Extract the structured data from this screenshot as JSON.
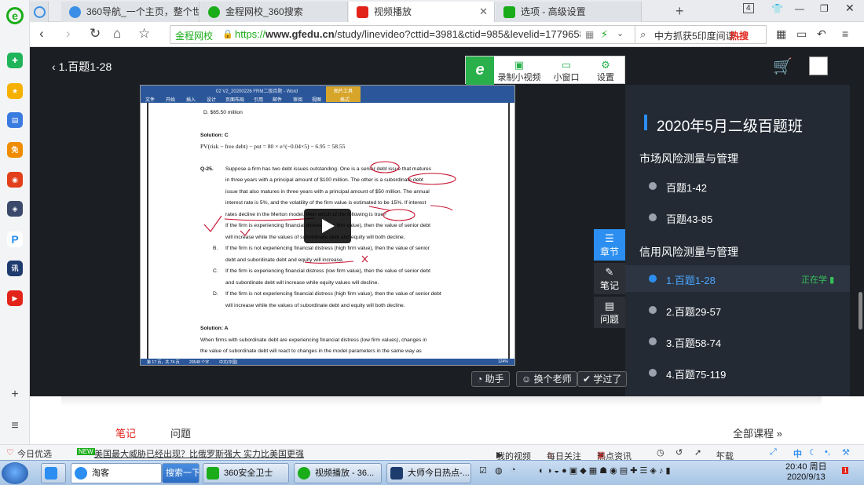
{
  "browser": {
    "tabs": [
      {
        "label": "360导航_一个主页，整个世界",
        "icon_color": "#3a8ee6"
      },
      {
        "label": "金程网校_360搜索",
        "icon_color": "#1aad19"
      },
      {
        "label": "视频播放",
        "icon_color": "#e2231a"
      },
      {
        "label": "选项 - 高级设置",
        "icon_color": "#1aad19"
      }
    ],
    "tab_count": "4",
    "address": {
      "site_badge": "金程网校",
      "scheme": "https://",
      "host": "www.gfedu.cn",
      "path": "/study/linevideo?cttid=3981&ctid=985&levelid=1779658"
    },
    "search": {
      "text": "中方抓获5印度间谍",
      "hot": "热搜"
    },
    "bottom_bar": {
      "weather": "今日优选",
      "news_badge": "NEW",
      "news": "美国最大威胁已经出现？比俄罗斯强大 实力比美国更强",
      "my_video": "我的视频",
      "daily": "每日关注",
      "hot_news": "热点资讯",
      "download": "下载",
      "ime": "中"
    }
  },
  "page": {
    "back_label": "1.百题1-28",
    "tools": [
      {
        "icon": "video-record-icon",
        "label": "录制小视频"
      },
      {
        "icon": "mini-window-icon",
        "label": "小窗口"
      },
      {
        "icon": "gear-icon",
        "label": "设置"
      }
    ],
    "side_buttons": [
      "章节",
      "笔记",
      "问题"
    ],
    "action_buttons": [
      "助手",
      "换个老师",
      "学过了"
    ],
    "bottom_tabs": [
      "笔记",
      "问题"
    ],
    "all_courses": "全部课程"
  },
  "panel": {
    "title": "2020年5月二级百题班",
    "sections": [
      {
        "name": "市场风险测量与管理",
        "items": [
          {
            "label": "百题1-42"
          },
          {
            "label": "百题43-85"
          }
        ]
      },
      {
        "name": "信用风险测量与管理",
        "items": [
          {
            "label": "1.百题1-28",
            "status": "正在学"
          },
          {
            "label": "2.百题29-57"
          },
          {
            "label": "3.百题58-74"
          },
          {
            "label": "4.百题75-119"
          }
        ]
      }
    ]
  },
  "document": {
    "word_title": "02 V2_20200226 FRM二级百题 - Word",
    "ribbon_tabs": [
      "文件",
      "开始",
      "插入",
      "设计",
      "页面布局",
      "引用",
      "邮件",
      "审阅",
      "视图",
      "格式"
    ],
    "ribbon_highlight": "图片工具",
    "lines": [
      "D.     $65.50 million",
      "Solution: C",
      "PV(risk − free debt) − put = 80 × e^(−0.04×5) − 6.95 = 58.55",
      "Q-25.",
      "Suppose a firm has two debt issues outstanding. One is a senior debt issue that matures",
      "in three years with a principal amount of $100 million. The other is a subordinate debt",
      "issue that also matures in three years with a principal amount of $50 million. The annual",
      "interest rate is 5%, and the volatility of the firm value is estimated to be 15%. If interest",
      "rates decline in the Merton model, then which of the following is true?",
      "If the firm is experiencing financial distress (low firm value), then the value of senior debt",
      "will increase while the values of subordinate debt and equity will both decline.",
      "B.",
      "If the firm is not experiencing financial distress (high firm value), then the value of senior",
      "debt and subordinate debt and equity will increase.",
      "C.",
      "If the firm is experiencing financial distress (low firm value), then the value of senior debt",
      "and subordinate debt will increase while equity values will decline.",
      "D.",
      "If the firm is not experiencing financial distress (high firm value), then the value of senior debt",
      "will increase while the values of subordinate debt and equity will both decline.",
      "Solution: A",
      "When firms with subordinate debt are experiencing financial distress (low firm values), changes in",
      "the value of subordinate debt will react to changes in the model parameters in the same way as"
    ],
    "status_page": "第 17 页，共 74 页",
    "status_words": "20548 个字",
    "status_lang": "中文(中国)",
    "zoom": "124%"
  },
  "taskbar": {
    "search_placeholder": "淘客",
    "search_btn": "搜索一下",
    "apps": [
      "360安全卫士",
      "视频播放 - 36...",
      "大师今日热点-..."
    ],
    "time": "20:40 周日",
    "date": "2020/9/13"
  }
}
